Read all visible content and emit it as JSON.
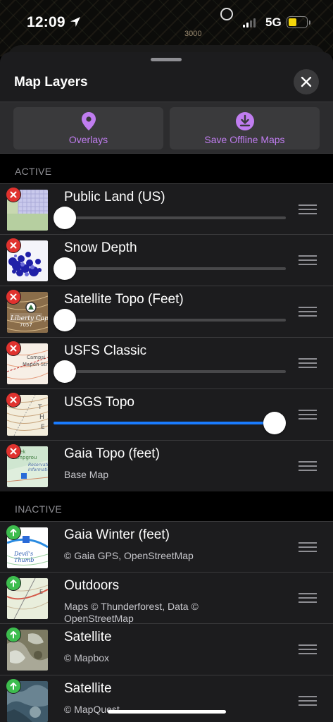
{
  "status_bar": {
    "time": "12:09",
    "network": "5G",
    "map_label": "3000",
    "battery_level": 0.44,
    "colors": {
      "battery": "#f5d60a"
    }
  },
  "sheet": {
    "title": "Map Layers",
    "close_icon": "close-icon"
  },
  "actions": {
    "overlays_label": "Overlays",
    "overlays_icon": "map-pin-icon",
    "offline_label": "Save Offline Maps",
    "offline_icon": "download-icon",
    "accent_color": "#c07df0"
  },
  "sections": {
    "active": "ACTIVE",
    "inactive": "INACTIVE"
  },
  "active_layers": [
    {
      "name": "Public Land (US)",
      "opacity": 0.0,
      "thumb": "public-land"
    },
    {
      "name": "Snow Depth",
      "opacity": 0.0,
      "thumb": "snow-depth"
    },
    {
      "name": "Satellite Topo (Feet)",
      "opacity": 0.0,
      "thumb": "satellite-topo"
    },
    {
      "name": "USFS Classic",
      "opacity": 0.0,
      "thumb": "usfs"
    },
    {
      "name": "USGS Topo",
      "opacity": 1.0,
      "thumb": "usgs"
    },
    {
      "name": "Gaia Topo (feet)",
      "subtitle": "Base Map",
      "thumb": "gaia-topo"
    }
  ],
  "inactive_layers": [
    {
      "name": "Gaia Winter (feet)",
      "subtitle": "© Gaia GPS, OpenStreetMap",
      "thumb": "gaia-winter"
    },
    {
      "name": "Outdoors",
      "subtitle": "Maps © Thunderforest, Data © OpenStreetMap",
      "thumb": "outdoors"
    },
    {
      "name": "Satellite",
      "subtitle": "© Mapbox",
      "thumb": "satellite-mapbox"
    },
    {
      "name": "Satellite",
      "subtitle": "© MapQuest",
      "thumb": "satellite-mapquest"
    }
  ],
  "colors": {
    "remove_badge": "#e0322e",
    "add_badge": "#3dbd4e",
    "slider_active": "#1a7cff"
  }
}
